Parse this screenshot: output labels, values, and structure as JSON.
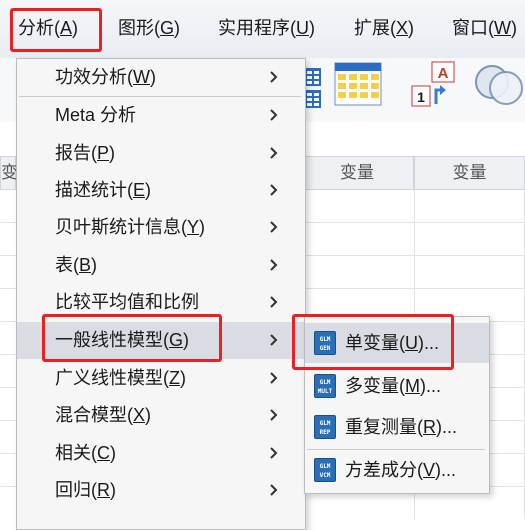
{
  "menubar": {
    "items": [
      {
        "text": "分析(",
        "key": "A",
        "end": ")"
      },
      {
        "text": "图形(",
        "key": "G",
        "end": ")"
      },
      {
        "text": "实用程序(",
        "key": "U",
        "end": ")"
      },
      {
        "text": "扩展(",
        "key": "X",
        "end": ")"
      },
      {
        "text": "窗口(",
        "key": "W",
        "end": ")"
      }
    ]
  },
  "grid": {
    "headers": [
      "变量",
      "变量"
    ],
    "left_cut": "变"
  },
  "menu": {
    "items": [
      {
        "text": "功效分析(",
        "key": "W",
        "end": ")"
      },
      {
        "text": "Meta 分析",
        "key": "",
        "end": ""
      },
      {
        "text": "报告(",
        "key": "P",
        "end": ")"
      },
      {
        "text": "描述统计(",
        "key": "E",
        "end": ")"
      },
      {
        "text": "贝叶斯统计信息(",
        "key": "Y",
        "end": ")"
      },
      {
        "text": "表(",
        "key": "B",
        "end": ")"
      },
      {
        "text": "比较平均值和比例",
        "key": "",
        "end": ""
      },
      {
        "text": "一般线性模型(",
        "key": "G",
        "end": ")"
      },
      {
        "text": "广义线性模型(",
        "key": "Z",
        "end": ")"
      },
      {
        "text": "混合模型(",
        "key": "X",
        "end": ")"
      },
      {
        "text": "相关(",
        "key": "C",
        "end": ")"
      },
      {
        "text": "回归(",
        "key": "R",
        "end": ")"
      }
    ]
  },
  "submenu": {
    "items": [
      {
        "text": "单变量(",
        "key": "U",
        "end": ")...",
        "icon": [
          "GLM",
          "GEN"
        ]
      },
      {
        "text": "多变量(",
        "key": "M",
        "end": ")...",
        "icon": [
          "GLM",
          "MULT"
        ]
      },
      {
        "text": "重复测量(",
        "key": "R",
        "end": ")...",
        "icon": [
          "GLM",
          "REP"
        ]
      },
      {
        "text": "方差成分(",
        "key": "V",
        "end": ")...",
        "icon": [
          "GLM",
          "VCM"
        ]
      }
    ]
  },
  "colors": {
    "highlight": "#ef1f1f",
    "menu_bg": "#f6f6f6",
    "active_bg": "#d9dde3"
  }
}
